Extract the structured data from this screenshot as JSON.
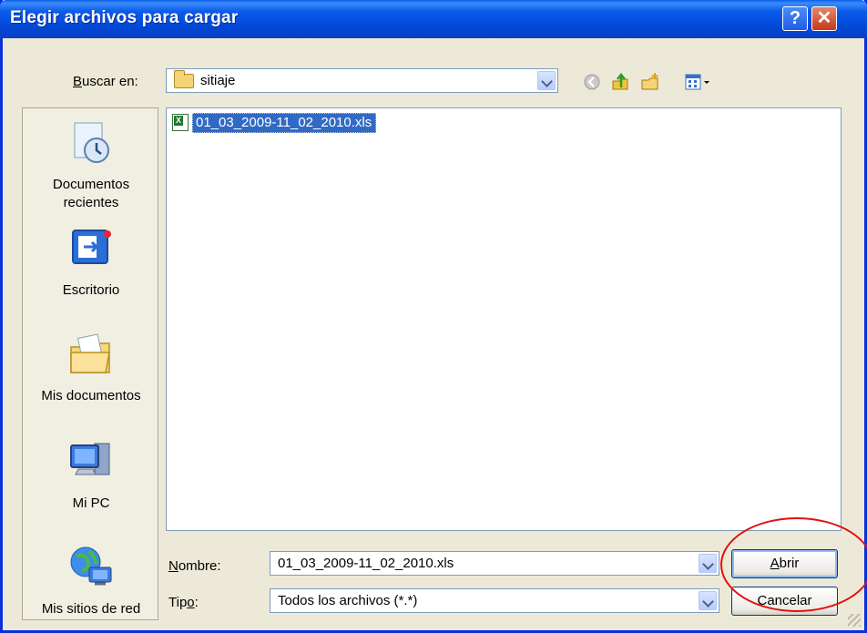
{
  "window": {
    "title": "Elegir archivos para cargar",
    "help": "?",
    "close": "✕"
  },
  "toolbar": {
    "look_in_label_key": "B",
    "look_in_label_rest": "uscar en:",
    "look_in_value": "sitiaje",
    "icons": [
      "back-icon",
      "up-folder-icon",
      "new-folder-icon",
      "view-menu-icon"
    ]
  },
  "places": [
    {
      "label_line1": "Documentos",
      "label_line2": "recientes",
      "icon": "recent-documents-icon"
    },
    {
      "label_line1": "Escritorio",
      "label_line2": "",
      "icon": "desktop-icon"
    },
    {
      "label_line1": "Mis documentos",
      "label_line2": "",
      "icon": "my-documents-icon"
    },
    {
      "label_line1": "Mi PC",
      "label_line2": "",
      "icon": "my-computer-icon"
    },
    {
      "label_line1": "Mis sitios de red",
      "label_line2": "",
      "icon": "network-places-icon"
    }
  ],
  "files": [
    {
      "name": "01_03_2009-11_02_2010.xls",
      "selected": true
    }
  ],
  "form": {
    "name_label_key": "N",
    "name_label_rest": "ombre:",
    "name_value": "01_03_2009-11_02_2010.xls",
    "type_label_pre": "Tip",
    "type_label_key": "o",
    "type_label_post": ":",
    "type_value": "Todos los archivos (*.*)"
  },
  "buttons": {
    "open_key": "A",
    "open_rest": "brir",
    "cancel": "Cancelar"
  },
  "colors": {
    "titlebar": "#0148d8",
    "selection": "#316ac5",
    "annotation": "#e01010"
  }
}
